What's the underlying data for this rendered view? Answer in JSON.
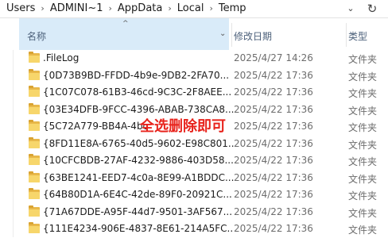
{
  "address": {
    "crumbs": [
      "Users",
      "ADMINI~1",
      "AppData",
      "Local",
      "Temp"
    ]
  },
  "columns": {
    "name": "名称",
    "date": "修改日期",
    "type": "类型"
  },
  "files": [
    {
      "name": ".FileLog",
      "date": "2025/4/27 14:26",
      "type": "文件夹"
    },
    {
      "name": "{0D73B9BD-FFDD-4b9e-9DB2-2FA70...",
      "date": "2025/4/22 17:36",
      "type": "文件夹"
    },
    {
      "name": "{1C07C078-61B3-46cd-9C3C-2F8AEE...",
      "date": "2025/4/22 17:36",
      "type": "文件夹"
    },
    {
      "name": "{03E34DFB-9FCC-4396-ABAB-738CA8...",
      "date": "2025/4/22 17:36",
      "type": "文件夹"
    },
    {
      "name": "{5C72A779-BB4A-4bc",
      "date": "2025/4/22 17:36",
      "type": "文件夹"
    },
    {
      "name": "{8FD11E8A-6765-40d5-9602-E98C801...",
      "date": "2025/4/22 17:36",
      "type": "文件夹"
    },
    {
      "name": "{10CFCBDB-27AF-4232-9886-403D58...",
      "date": "2025/4/22 17:36",
      "type": "文件夹"
    },
    {
      "name": "{63BE1241-EED7-4c0a-8E99-A1BDDC...",
      "date": "2025/4/22 17:36",
      "type": "文件夹"
    },
    {
      "name": "{64B80D1A-6E4C-42de-89F0-20921C...",
      "date": "2025/4/22 17:36",
      "type": "文件夹"
    },
    {
      "name": "{71A67DDE-A95F-44d7-9501-3AF567...",
      "date": "2025/4/22 17:36",
      "type": "文件夹"
    },
    {
      "name": "{111E4234-906E-4837-8E61-214A5FC...",
      "date": "2025/4/22 17:36",
      "type": "文件夹"
    }
  ],
  "overlay_text": "全选删除即可"
}
